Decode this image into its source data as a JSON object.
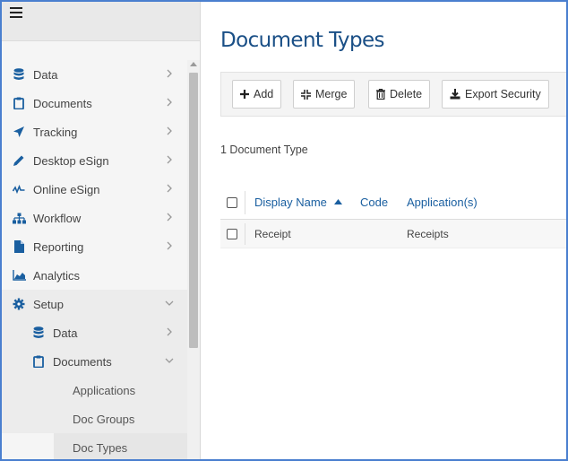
{
  "sidebar": {
    "items": [
      {
        "label": "Data",
        "icon": "database-icon"
      },
      {
        "label": "Documents",
        "icon": "clipboard-icon"
      },
      {
        "label": "Tracking",
        "icon": "paper-plane-icon"
      },
      {
        "label": "Desktop eSign",
        "icon": "pen-icon"
      },
      {
        "label": "Online eSign",
        "icon": "signature-icon"
      },
      {
        "label": "Workflow",
        "icon": "sitemap-icon"
      },
      {
        "label": "Reporting",
        "icon": "file-icon"
      },
      {
        "label": "Analytics",
        "icon": "area-chart-icon"
      },
      {
        "label": "Setup",
        "icon": "gear-icon"
      }
    ],
    "setup_sub": [
      {
        "label": "Data",
        "icon": "database-icon"
      },
      {
        "label": "Documents",
        "icon": "clipboard-icon"
      }
    ],
    "documents_sub": [
      "Applications",
      "Doc Groups",
      "Doc Types"
    ]
  },
  "main": {
    "title": "Document Types",
    "toolbar": {
      "add": "Add",
      "merge": "Merge",
      "delete": "Delete",
      "export": "Export Security"
    },
    "count": "1 Document Type",
    "table": {
      "columns": [
        "Display Name",
        "Code",
        "Application(s)"
      ],
      "rows": [
        {
          "display_name": "Receipt",
          "code": "",
          "applications": "Receipts"
        }
      ]
    }
  },
  "colors": {
    "accent": "#1a5fa0",
    "title": "#1a4f86",
    "frame": "#4a7fcf"
  }
}
